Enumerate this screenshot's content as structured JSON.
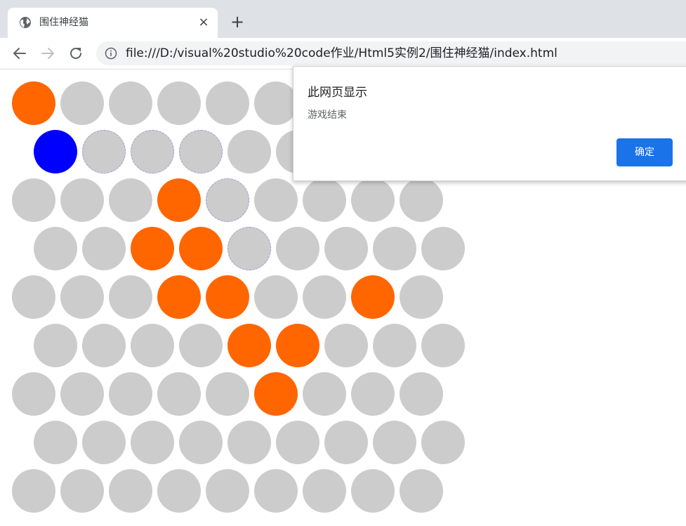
{
  "browser": {
    "tab": {
      "title": "围住神经猫",
      "favicon": "globe-icon",
      "close_icon": "close-icon"
    },
    "new_tab_icon": "plus-icon",
    "nav": {
      "back_icon": "back-arrow-icon",
      "forward_icon": "forward-arrow-icon",
      "reload_icon": "reload-icon"
    },
    "address_bar": {
      "info_icon": "info-icon",
      "url": "file:///D:/visual%20studio%20code作业/Html5实例2/围住神经猫/index.html"
    }
  },
  "game": {
    "colors": {
      "empty": "#cccccc",
      "blocked": "#ff6600",
      "cat": "#0000ff",
      "path_outline": "#9a9ad8"
    },
    "grid": [
      [
        "blocked",
        "empty",
        "empty",
        "empty",
        "empty",
        "empty",
        "empty",
        "empty",
        "empty"
      ],
      [
        "cat",
        "path",
        "path",
        "path",
        "empty",
        "empty",
        "empty",
        "empty",
        "empty"
      ],
      [
        "empty",
        "empty",
        "empty",
        "blocked",
        "path",
        "empty",
        "empty",
        "empty",
        "empty"
      ],
      [
        "empty",
        "empty",
        "blocked",
        "blocked",
        "path",
        "empty",
        "empty",
        "empty",
        "empty"
      ],
      [
        "empty",
        "empty",
        "empty",
        "blocked",
        "blocked",
        "empty",
        "empty",
        "blocked",
        "empty"
      ],
      [
        "empty",
        "empty",
        "empty",
        "empty",
        "blocked",
        "blocked",
        "empty",
        "empty",
        "empty"
      ],
      [
        "empty",
        "empty",
        "empty",
        "empty",
        "empty",
        "blocked",
        "empty",
        "empty",
        "empty"
      ],
      [
        "empty",
        "empty",
        "empty",
        "empty",
        "empty",
        "empty",
        "empty",
        "empty",
        "empty"
      ],
      [
        "empty",
        "empty",
        "empty",
        "empty",
        "empty",
        "empty",
        "empty",
        "empty",
        "empty"
      ]
    ]
  },
  "dialog": {
    "title": "此网页显示",
    "message": "游戏结束",
    "ok_label": "确定"
  }
}
